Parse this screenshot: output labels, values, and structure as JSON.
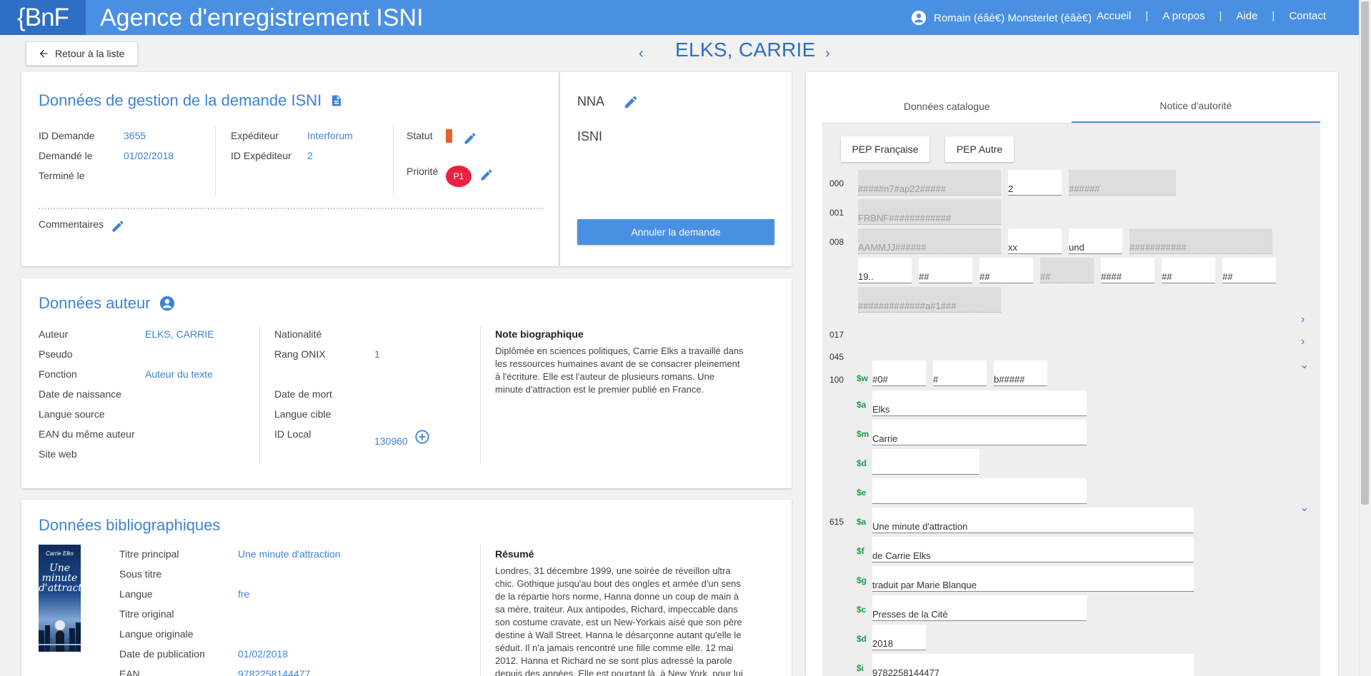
{
  "header": {
    "logo": "{BnF",
    "title": "Agence d'enregistrement ISNI",
    "user": "Romain (éâè€) Monsterlet (éâè€)",
    "nav": [
      "Accueil",
      "A propos",
      "Aide",
      "Contact"
    ]
  },
  "subheader": {
    "back_label": "Retour à la liste",
    "record_title": "ELKS, CARRIE",
    "prev": "‹",
    "next": "›"
  },
  "gestion": {
    "title": "Données de gestion de la demande ISNI",
    "id_demande_label": "ID Demande",
    "id_demande": "3655",
    "demande_le_label": "Demandé le",
    "demande_le": "01/02/2018",
    "termine_le_label": "Terminé le",
    "expediteur_label": "Expéditeur",
    "expediteur": "Interforum",
    "id_expediteur_label": "ID Expéditeur",
    "id_expediteur": "2",
    "statut_label": "Statut",
    "priorite_label": "Priorité",
    "priorite": "P1",
    "commentaires_label": "Commentaires",
    "status_color": "#e7622c"
  },
  "nna": {
    "nna_label": "NNA",
    "isni_label": "ISNI",
    "cancel_label": "Annuler la demande"
  },
  "auteur": {
    "title": "Données auteur",
    "auteur_label": "Auteur",
    "auteur": "ELKS, CARRIE",
    "pseudo_label": "Pseudo",
    "fonction_label": "Fonction",
    "fonction": "Auteur du texte",
    "naissance_label": "Date de naissance",
    "langue_source_label": "Langue source",
    "ean_label": "EAN du même auteur",
    "site_label": "Site web",
    "nationalite_label": "Nationalité",
    "rang_label": "Rang ONIX",
    "rang": "1",
    "mort_label": "Date de mort",
    "langue_cible_label": "Langue cible",
    "id_local_label": "ID Local",
    "id_local": "130960",
    "note_title": "Note biographique",
    "note_lines": [
      "Diplômée en sciences politiques, Carrie Elks a travaillé dans",
      "les ressources humaines avant de se consacrer pleinement",
      "à l'écriture. Elle est l'auteur de plusieurs romans. Une",
      "minute d'attraction est le premier publié en France."
    ]
  },
  "biblio": {
    "title": "Données bibliographiques",
    "cover_author": "Carrie Elks",
    "cover_title_1": "Une minute",
    "cover_title_2": "d'attraction",
    "titre_label": "Titre principal",
    "titre": "Une minute d'attraction",
    "sous_titre_label": "Sous titre",
    "langue_label": "Langue",
    "langue": "fre",
    "titre_original_label": "Titre original",
    "langue_originale_label": "Langue originale",
    "date_pub_label": "Date de publication",
    "date_pub": "01/02/2018",
    "ean_label": "EAN",
    "ean": "9782258144477",
    "resume_title": "Résumé",
    "resume_lines": [
      "Londres, 31 décembre 1999, une soirée de réveillon ultra",
      "chic. Gothique jusqu'au bout des ongles et armée d'un sens",
      "de la répartie hors norme, Hanna donne un coup de main à",
      "sa mère, traiteur. Aux antipodes, Richard, impeccable dans",
      "son costume cravate, est un New-Yorkais aisé que son père",
      "destine à Wall Street. Hanna le désarçonne autant qu'elle le",
      "séduit. Il n'a jamais rencontré une fille comme elle. 12 mai",
      "2012. Hanna et Richard ne se sont plus adressé la parole",
      "depuis des années. Elle est pourtant là, à New York, pour lui"
    ]
  },
  "catalog": {
    "tabs": [
      "Données catalogue",
      "Notice d'autorité"
    ],
    "pep_fr": "PEP Française",
    "pep_autre": "PEP Autre",
    "tags": {
      "t000": "000",
      "t001": "001",
      "t008": "008",
      "t017": "017",
      "t045": "045",
      "t100": "100",
      "t615": "615"
    },
    "f000": [
      "#####n7#ap22#####",
      "2",
      "######"
    ],
    "f001": "FRBNF############",
    "f008a": [
      "AAMMJJ######",
      "xx",
      "und",
      "###########"
    ],
    "f008b": [
      "19..",
      "##",
      "##",
      "##",
      "####",
      "##",
      "##"
    ],
    "f008c": "#############a#1###",
    "f100": {
      "w_label": "$w",
      "w": [
        "#0#",
        "#",
        "b#####"
      ],
      "a_label": "$a",
      "a": "Elks",
      "m_label": "$m",
      "m": "Carrie",
      "d_label": "$d",
      "d": "",
      "e_label": "$e",
      "e": ""
    },
    "f615": {
      "a_label": "$a",
      "a": "Une minute d'attraction",
      "f_label": "$f",
      "f": "de Carrie Elks",
      "g_label": "$g",
      "g": "traduit par Marie Blanque",
      "c_label": "$c",
      "c": "Presses de la Cité",
      "d_label": "$d",
      "d": "2018",
      "i_label": "$i",
      "i": "9782258144477"
    }
  }
}
